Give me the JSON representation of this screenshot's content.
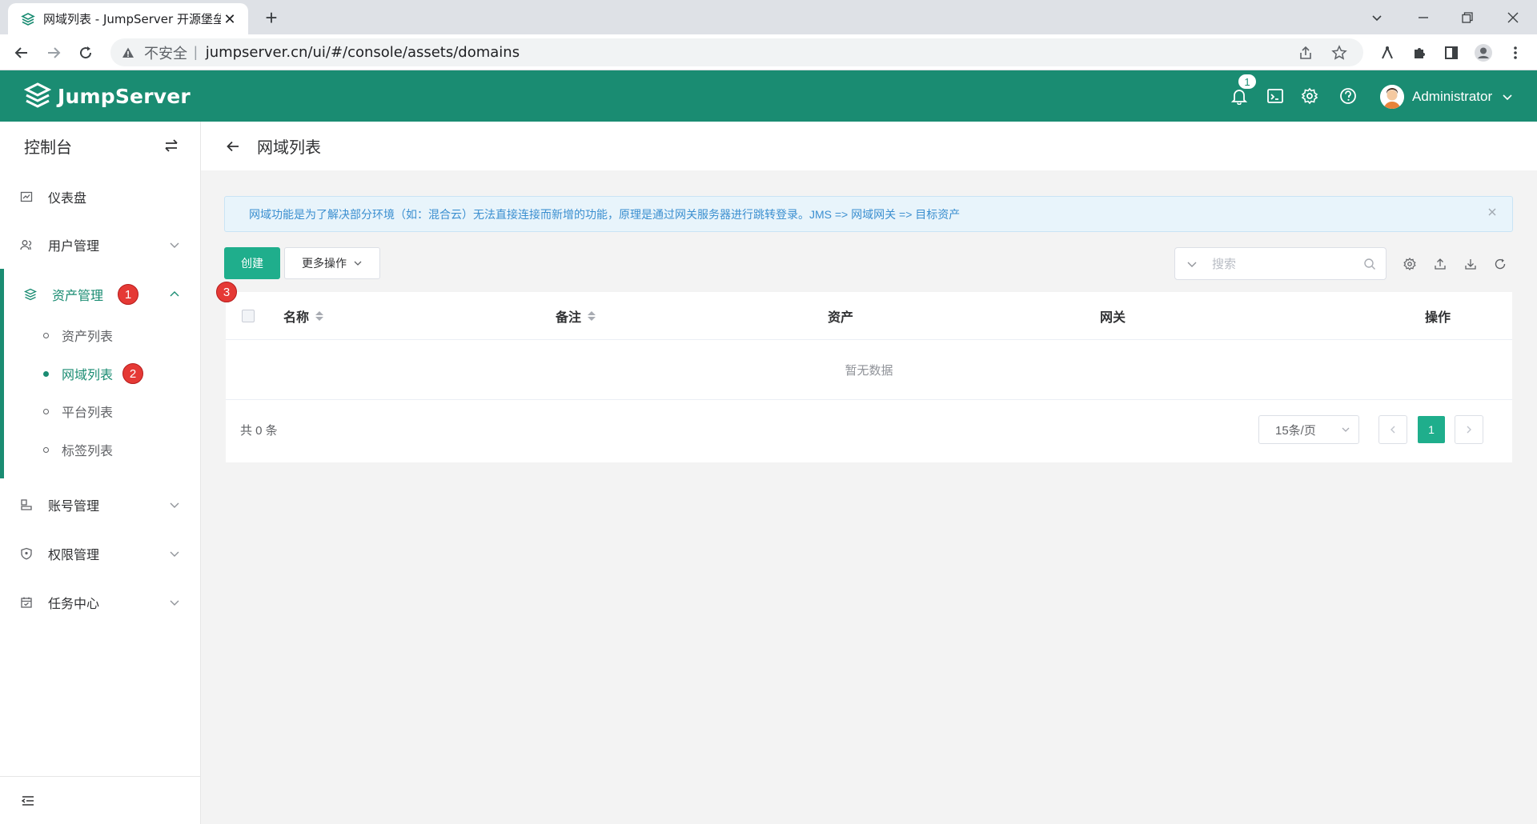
{
  "browser": {
    "tab_title": "网域列表 - JumpServer 开源堡垒",
    "tab_close": "✕",
    "new_tab": "+",
    "security_label": "不安全",
    "url": "jumpserver.cn/ui/#/console/assets/domains"
  },
  "header": {
    "brand": "JumpServer",
    "notification_count": "1",
    "user_name": "Administrator",
    "accent_color": "#1a8c72"
  },
  "sidebar": {
    "title": "控制台",
    "items": [
      {
        "label": "仪表盘",
        "icon": "dashboard-icon"
      },
      {
        "label": "用户管理",
        "icon": "users-icon"
      },
      {
        "label": "资产管理",
        "icon": "layers-icon",
        "badge": "1"
      },
      {
        "label": "账号管理",
        "icon": "account-icon"
      },
      {
        "label": "权限管理",
        "icon": "shield-icon"
      },
      {
        "label": "任务中心",
        "icon": "calendar-icon"
      }
    ],
    "subitems": [
      {
        "label": "资产列表"
      },
      {
        "label": "网域列表",
        "badge": "2"
      },
      {
        "label": "平台列表"
      },
      {
        "label": "标签列表"
      }
    ]
  },
  "page": {
    "title": "网域列表",
    "alert": "网域功能是为了解决部分环境（如：混合云）无法直接连接而新增的功能，原理是通过网关服务器进行跳转登录。JMS => 网域网关 => 目标资产",
    "create_button": "创建",
    "more_actions": "更多操作",
    "search_placeholder": "搜索",
    "marker_badge": "3"
  },
  "table": {
    "columns": [
      "名称",
      "备注",
      "资产",
      "网关",
      "操作"
    ],
    "empty_text": "暂无数据",
    "total_text": "共 0 条",
    "page_size": "15条/页",
    "current_page": "1"
  }
}
